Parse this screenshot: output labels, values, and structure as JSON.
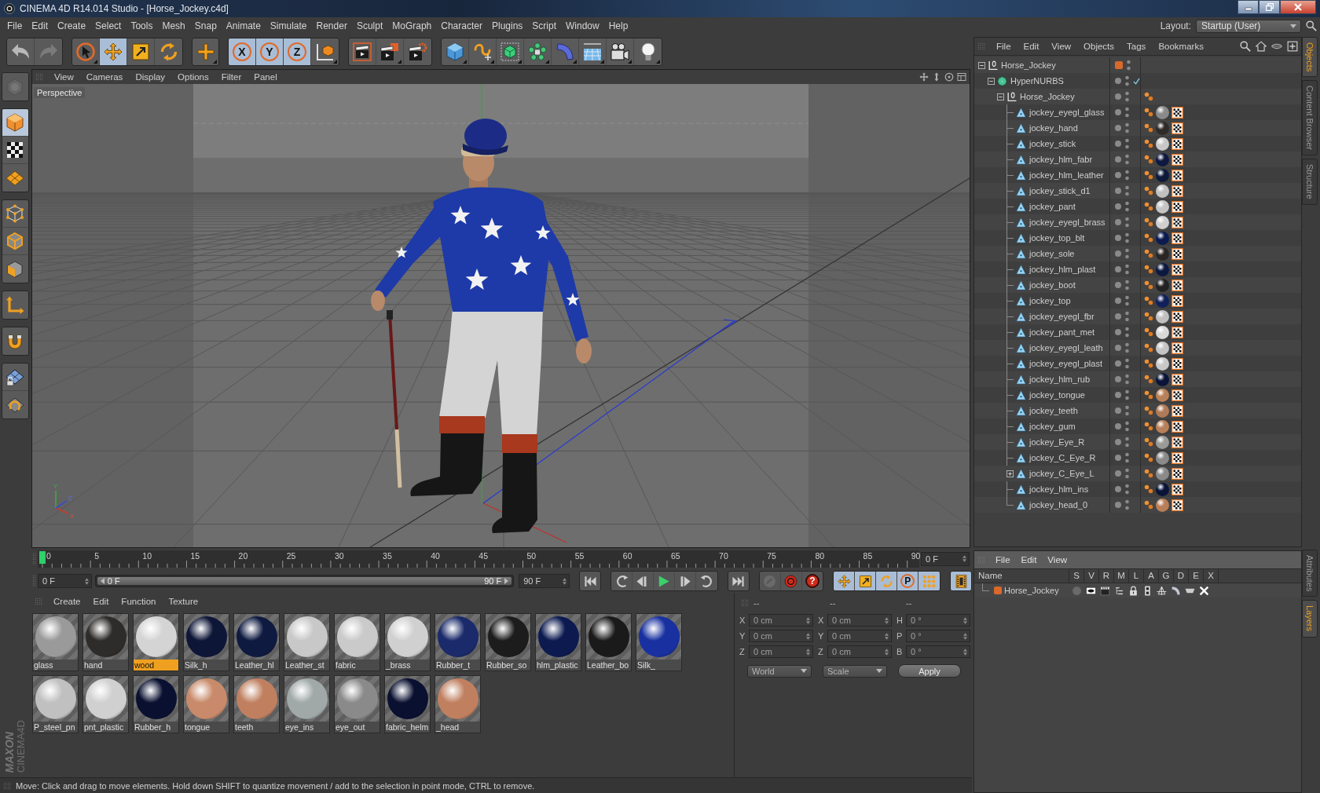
{
  "window": {
    "title": "CINEMA 4D R14.014 Studio - [Horse_Jockey.c4d]"
  },
  "menu": [
    "File",
    "Edit",
    "Create",
    "Select",
    "Tools",
    "Mesh",
    "Snap",
    "Animate",
    "Simulate",
    "Render",
    "Sculpt",
    "MoGraph",
    "Character",
    "Plugins",
    "Script",
    "Window",
    "Help"
  ],
  "layout": {
    "label": "Layout:",
    "value": "Startup (User)"
  },
  "toolbar": [
    [
      {
        "kind": "undo",
        "on": false,
        "disabled": false
      },
      {
        "kind": "redo",
        "on": false,
        "disabled": true
      }
    ],
    [
      {
        "kind": "select",
        "on": false,
        "disabled": false
      },
      {
        "kind": "move",
        "on": true,
        "disabled": false
      },
      {
        "kind": "scale",
        "on": false,
        "disabled": false
      },
      {
        "kind": "rotate",
        "on": false,
        "disabled": false
      }
    ],
    [
      {
        "kind": "add",
        "on": false,
        "disabled": false
      }
    ],
    [
      {
        "kind": "axis",
        "label": "X",
        "on": true,
        "disabled": false
      },
      {
        "kind": "axis",
        "label": "Y",
        "on": true,
        "disabled": false
      },
      {
        "kind": "axis",
        "label": "Z",
        "on": true,
        "disabled": false
      },
      {
        "kind": "coords",
        "on": false,
        "disabled": false
      }
    ],
    [
      {
        "kind": "renderview",
        "on": false,
        "disabled": false
      },
      {
        "kind": "renderpicture",
        "on": false,
        "disabled": false
      },
      {
        "kind": "rendersettings",
        "on": false,
        "disabled": false
      }
    ],
    [
      {
        "kind": "cube",
        "on": false,
        "disabled": false
      },
      {
        "kind": "pen",
        "on": false,
        "disabled": false
      },
      {
        "kind": "subdivision",
        "on": false,
        "disabled": false
      },
      {
        "kind": "cloner",
        "on": false,
        "disabled": false
      },
      {
        "kind": "bend",
        "on": false,
        "disabled": false
      },
      {
        "kind": "floor",
        "on": false,
        "disabled": false
      },
      {
        "kind": "camera",
        "on": false,
        "disabled": false
      },
      {
        "kind": "light",
        "on": false,
        "disabled": false
      }
    ]
  ],
  "tools": [
    [
      {
        "kind": "editable",
        "selected": false,
        "disabled": true
      }
    ],
    [
      {
        "kind": "model",
        "selected": true,
        "disabled": false
      },
      {
        "kind": "texture",
        "selected": false,
        "disabled": false
      },
      {
        "kind": "workplane",
        "selected": false,
        "disabled": false
      }
    ],
    [
      {
        "kind": "pointmode",
        "selected": false,
        "disabled": false
      },
      {
        "kind": "edgemode",
        "selected": false,
        "disabled": false
      },
      {
        "kind": "polymode",
        "selected": false,
        "disabled": false
      }
    ],
    [
      {
        "kind": "enableaxis",
        "selected": false,
        "disabled": false
      }
    ],
    [
      {
        "kind": "snap",
        "selected": false,
        "disabled": false
      }
    ],
    [
      {
        "kind": "lockplane",
        "selected": false,
        "disabled": false
      },
      {
        "kind": "planar",
        "selected": false,
        "disabled": false
      }
    ]
  ],
  "viewport": {
    "menu": [
      "View",
      "Cameras",
      "Display",
      "Options",
      "Filter",
      "Panel"
    ],
    "camera": "Perspective",
    "axis_labels": [
      "Y",
      "Z",
      "X"
    ]
  },
  "timeline": {
    "labels": [
      "0",
      "5",
      "10",
      "15",
      "20",
      "25",
      "30",
      "35",
      "40",
      "45",
      "50",
      "55",
      "60",
      "65",
      "70",
      "75",
      "80",
      "85",
      "90"
    ],
    "playhead": {
      "level": 0
    },
    "frame": "0 F"
  },
  "transport": {
    "start": "0 F",
    "range": {
      "start": "0 F",
      "end": "90 F",
      "level": 1
    },
    "end": "90 F",
    "buttons": [
      [
        {
          "kind": "first",
          "on": false,
          "disabled": false
        }
      ],
      [
        {
          "kind": "loopback",
          "on": false,
          "disabled": false
        },
        {
          "kind": "prev",
          "on": false,
          "disabled": false
        },
        {
          "kind": "play",
          "on": false,
          "disabled": false
        },
        {
          "kind": "next",
          "on": false,
          "disabled": false
        },
        {
          "kind": "loop",
          "on": false,
          "disabled": false
        }
      ],
      [
        {
          "kind": "last",
          "on": false,
          "disabled": false
        }
      ],
      [
        {
          "kind": "key",
          "on": false,
          "disabled": true
        },
        {
          "kind": "record",
          "on": false,
          "disabled": false
        },
        {
          "kind": "help",
          "label": "?",
          "on": false,
          "disabled": false
        }
      ],
      [
        {
          "kind": "move",
          "on": true,
          "disabled": false
        },
        {
          "kind": "scale",
          "on": true,
          "disabled": false
        },
        {
          "kind": "rotate",
          "on": true,
          "disabled": false
        },
        {
          "kind": "param",
          "label": "P",
          "on": true,
          "disabled": false
        },
        {
          "kind": "points",
          "on": true,
          "disabled": false
        }
      ],
      [
        {
          "kind": "film",
          "on": true,
          "disabled": false
        }
      ]
    ]
  },
  "materials": {
    "menu": [
      "Create",
      "Edit",
      "Function",
      "Texture"
    ],
    "items": [
      {
        "name": "glass",
        "color": "#9a9a9a",
        "selected": false
      },
      {
        "name": "hand",
        "color": "#2e2c2a",
        "selected": false
      },
      {
        "name": "wood",
        "color": "#d4d4d4",
        "selected": true
      },
      {
        "name": "Silk_h",
        "color": "#0e1638",
        "selected": false
      },
      {
        "name": "Leather_hl",
        "color": "#0e1a40",
        "selected": false
      },
      {
        "name": "Leather_st",
        "color": "#c8c8c8",
        "selected": false
      },
      {
        "name": "fabric",
        "color": "#cacaca",
        "selected": false
      },
      {
        "name": "_brass",
        "color": "#d0d0d0",
        "selected": false
      },
      {
        "name": "Rubber_t",
        "color": "#1a2a6a",
        "selected": false
      },
      {
        "name": "Rubber_so",
        "color": "#1c1c1c",
        "selected": false
      },
      {
        "name": "hlm_plastic",
        "color": "#0c1a50",
        "selected": false
      },
      {
        "name": "Leather_bo",
        "color": "#1a1a1a",
        "selected": false
      },
      {
        "name": "Silk_",
        "color": "#1830a0",
        "selected": false
      },
      {
        "name": "P_steel_pn",
        "color": "#c0c0c0",
        "selected": false
      },
      {
        "name": "pnt_plastic",
        "color": "#d0d0d0",
        "selected": false
      },
      {
        "name": "Rubber_h",
        "color": "#0a1030",
        "selected": false
      },
      {
        "name": "tongue",
        "color": "#c88a6a",
        "selected": false
      },
      {
        "name": "teeth",
        "color": "#c08060",
        "selected": false
      },
      {
        "name": "eye_ins",
        "color": "#a0a8a8",
        "selected": false
      },
      {
        "name": "eye_out",
        "color": "#8a8a8a",
        "selected": false
      },
      {
        "name": "fabric_helm",
        "color": "#0a1030",
        "selected": false
      },
      {
        "name": "_head",
        "color": "#c08060",
        "selected": false
      }
    ]
  },
  "coordinates": {
    "headers": [
      "--",
      "--",
      "--"
    ],
    "rows": [
      [
        {
          "axis": "X",
          "value": "0 cm"
        },
        {
          "axis": "X",
          "value": "0 cm"
        },
        {
          "axis": "H",
          "value": "0 °"
        }
      ],
      [
        {
          "axis": "Y",
          "value": "0 cm"
        },
        {
          "axis": "Y",
          "value": "0 cm"
        },
        {
          "axis": "P",
          "value": "0 °"
        }
      ],
      [
        {
          "axis": "Z",
          "value": "0 cm"
        },
        {
          "axis": "Z",
          "value": "0 cm"
        },
        {
          "axis": "B",
          "value": "0 °"
        }
      ]
    ],
    "modes": [
      "World",
      "Scale"
    ],
    "apply": "Apply",
    "disabled": true
  },
  "status": "Move: Click and drag to move elements. Hold down SHIFT to quantize movement / add to the selection in point mode, CTRL to remove.",
  "brand": [
    "MAXON",
    "CINEMA4D"
  ],
  "object_manager": {
    "menu": [
      "File",
      "Edit",
      "View",
      "Objects",
      "Tags",
      "Bookmarks"
    ],
    "tabs": [
      {
        "label": "Objects",
        "selected": true
      },
      {
        "label": "Content Browser",
        "selected": false
      },
      {
        "label": "Structure",
        "selected": false
      }
    ],
    "objects": [
      {
        "name": "Horse_Jockey",
        "kind": "null",
        "expanded": true,
        "color": "#d8692a",
        "children": [
          {
            "name": "HyperNURBS",
            "kind": "nurbs",
            "expanded": true,
            "enabled": true,
            "children": [
              {
                "name": "Horse_Jockey",
                "kind": "null",
                "expanded": true,
                "tags": [
                  {
                    "kind": "dots"
                  }
                ],
                "children": [
                  {
                    "name": "jockey_eyegl_glass",
                    "kind": "polygon",
                    "tags": [
                      {
                        "kind": "dots"
                      },
                      {
                        "kind": "material",
                        "color": "#8a8a8a"
                      },
                      {
                        "kind": "checker"
                      }
                    ]
                  },
                  {
                    "name": "jockey_hand",
                    "kind": "polygon",
                    "tags": [
                      {
                        "kind": "dots"
                      },
                      {
                        "kind": "material",
                        "color": "#2e2a28"
                      },
                      {
                        "kind": "checker"
                      }
                    ]
                  },
                  {
                    "name": "jockey_stick",
                    "kind": "polygon",
                    "tags": [
                      {
                        "kind": "dots"
                      },
                      {
                        "kind": "material",
                        "color": "#c8c8c8"
                      },
                      {
                        "kind": "checker"
                      }
                    ]
                  },
                  {
                    "name": "jockey_hlm_fabr",
                    "kind": "polygon",
                    "tags": [
                      {
                        "kind": "dots"
                      },
                      {
                        "kind": "material",
                        "color": "#0e1840"
                      },
                      {
                        "kind": "checker"
                      }
                    ]
                  },
                  {
                    "name": "jockey_hlm_leather",
                    "kind": "polygon",
                    "tags": [
                      {
                        "kind": "dots"
                      },
                      {
                        "kind": "material",
                        "color": "#0e1a3a"
                      },
                      {
                        "kind": "checker"
                      }
                    ]
                  },
                  {
                    "name": "jockey_stick_d1",
                    "kind": "polygon",
                    "tags": [
                      {
                        "kind": "dots"
                      },
                      {
                        "kind": "material",
                        "color": "#c0c0c0"
                      },
                      {
                        "kind": "checker"
                      }
                    ]
                  },
                  {
                    "name": "jockey_pant",
                    "kind": "polygon",
                    "tags": [
                      {
                        "kind": "dots"
                      },
                      {
                        "kind": "material",
                        "color": "#c4c4c4"
                      },
                      {
                        "kind": "checker"
                      }
                    ]
                  },
                  {
                    "name": "jockey_eyegl_brass",
                    "kind": "polygon",
                    "tags": [
                      {
                        "kind": "dots"
                      },
                      {
                        "kind": "material",
                        "color": "#cfcfcf"
                      },
                      {
                        "kind": "checker"
                      }
                    ]
                  },
                  {
                    "name": "jockey_top_blt",
                    "kind": "polygon",
                    "tags": [
                      {
                        "kind": "dots"
                      },
                      {
                        "kind": "material",
                        "color": "#0c1a50"
                      },
                      {
                        "kind": "checker"
                      }
                    ]
                  },
                  {
                    "name": "jockey_sole",
                    "kind": "polygon",
                    "tags": [
                      {
                        "kind": "dots"
                      },
                      {
                        "kind": "material",
                        "color": "#2a2624"
                      },
                      {
                        "kind": "checker"
                      }
                    ]
                  },
                  {
                    "name": "jockey_hlm_plast",
                    "kind": "polygon",
                    "tags": [
                      {
                        "kind": "dots"
                      },
                      {
                        "kind": "material",
                        "color": "#0c1840"
                      },
                      {
                        "kind": "checker"
                      }
                    ]
                  },
                  {
                    "name": "jockey_boot",
                    "kind": "polygon",
                    "tags": [
                      {
                        "kind": "dots"
                      },
                      {
                        "kind": "material",
                        "color": "#222222"
                      },
                      {
                        "kind": "checker"
                      }
                    ]
                  },
                  {
                    "name": "jockey_top",
                    "kind": "polygon",
                    "tags": [
                      {
                        "kind": "dots"
                      },
                      {
                        "kind": "material",
                        "color": "#10205a"
                      },
                      {
                        "kind": "checker"
                      }
                    ]
                  },
                  {
                    "name": "jockey_eyegl_fbr",
                    "kind": "polygon",
                    "tags": [
                      {
                        "kind": "dots"
                      },
                      {
                        "kind": "material",
                        "color": "#c0c0c0"
                      },
                      {
                        "kind": "checker"
                      }
                    ]
                  },
                  {
                    "name": "jockey_pant_met",
                    "kind": "polygon",
                    "tags": [
                      {
                        "kind": "dots"
                      },
                      {
                        "kind": "material",
                        "color": "#d8d8d8"
                      },
                      {
                        "kind": "checker"
                      }
                    ]
                  },
                  {
                    "name": "jockey_eyegl_leath",
                    "kind": "polygon",
                    "tags": [
                      {
                        "kind": "dots"
                      },
                      {
                        "kind": "material",
                        "color": "#c4c4c4"
                      },
                      {
                        "kind": "checker"
                      }
                    ]
                  },
                  {
                    "name": "jockey_eyegl_plast",
                    "kind": "polygon",
                    "tags": [
                      {
                        "kind": "dots"
                      },
                      {
                        "kind": "material",
                        "color": "#c8c8c8"
                      },
                      {
                        "kind": "checker"
                      }
                    ]
                  },
                  {
                    "name": "jockey_hlm_rub",
                    "kind": "polygon",
                    "tags": [
                      {
                        "kind": "dots"
                      },
                      {
                        "kind": "material",
                        "color": "#0a1438"
                      },
                      {
                        "kind": "checker"
                      }
                    ]
                  },
                  {
                    "name": "jockey_tongue",
                    "kind": "polygon",
                    "tags": [
                      {
                        "kind": "dots"
                      },
                      {
                        "kind": "material",
                        "color": "#b88058"
                      },
                      {
                        "kind": "checker"
                      }
                    ]
                  },
                  {
                    "name": "jockey_teeth",
                    "kind": "polygon",
                    "tags": [
                      {
                        "kind": "dots"
                      },
                      {
                        "kind": "material",
                        "color": "#b07a58"
                      },
                      {
                        "kind": "checker"
                      }
                    ]
                  },
                  {
                    "name": "jockey_gum",
                    "kind": "polygon",
                    "tags": [
                      {
                        "kind": "dots"
                      },
                      {
                        "kind": "material",
                        "color": "#b88058"
                      },
                      {
                        "kind": "checker"
                      }
                    ]
                  },
                  {
                    "name": "jockey_Eye_R",
                    "kind": "polygon",
                    "tags": [
                      {
                        "kind": "dots"
                      },
                      {
                        "kind": "material",
                        "color": "#9a9a98"
                      },
                      {
                        "kind": "checker"
                      }
                    ]
                  },
                  {
                    "name": "jockey_C_Eye_R",
                    "kind": "polygon",
                    "tags": [
                      {
                        "kind": "dots"
                      },
                      {
                        "kind": "material",
                        "color": "#8a8a8a"
                      },
                      {
                        "kind": "checker"
                      }
                    ]
                  },
                  {
                    "name": "jockey_C_Eye_L",
                    "kind": "polygon",
                    "expanded": false,
                    "tags": [
                      {
                        "kind": "dots"
                      },
                      {
                        "kind": "material",
                        "color": "#8a8a8a"
                      },
                      {
                        "kind": "checker"
                      }
                    ]
                  },
                  {
                    "name": "jockey_hlm_ins",
                    "kind": "polygon",
                    "tags": [
                      {
                        "kind": "dots"
                      },
                      {
                        "kind": "material",
                        "color": "#0a1438"
                      },
                      {
                        "kind": "checker"
                      }
                    ]
                  },
                  {
                    "name": "jockey_head_0",
                    "kind": "polygon",
                    "tags": [
                      {
                        "kind": "dots"
                      },
                      {
                        "kind": "material",
                        "color": "#b87e58"
                      },
                      {
                        "kind": "checker"
                      }
                    ]
                  }
                ]
              }
            ]
          }
        ]
      }
    ]
  },
  "layers": {
    "menu": [
      "File",
      "Edit",
      "View"
    ],
    "columns": [
      "Name",
      "S",
      "V",
      "R",
      "M",
      "L",
      "A",
      "G",
      "D",
      "E",
      "X"
    ],
    "rows": [
      {
        "name": "Horse_Jockey",
        "color": "#d8692a",
        "flags": [
          {
            "kind": "solo",
            "on": false
          },
          {
            "kind": "view",
            "on": true
          },
          {
            "kind": "render",
            "on": true
          },
          {
            "kind": "manager",
            "on": true
          },
          {
            "kind": "locked",
            "on": true
          },
          {
            "kind": "animation",
            "on": true
          },
          {
            "kind": "generators",
            "on": true
          },
          {
            "kind": "deformers",
            "on": true
          },
          {
            "kind": "expressions",
            "on": true
          },
          {
            "kind": "xrefs",
            "on": true
          }
        ]
      }
    ],
    "tabs": [
      {
        "label": "Attributes",
        "selected": false
      },
      {
        "label": "Layers",
        "selected": true
      }
    ]
  }
}
